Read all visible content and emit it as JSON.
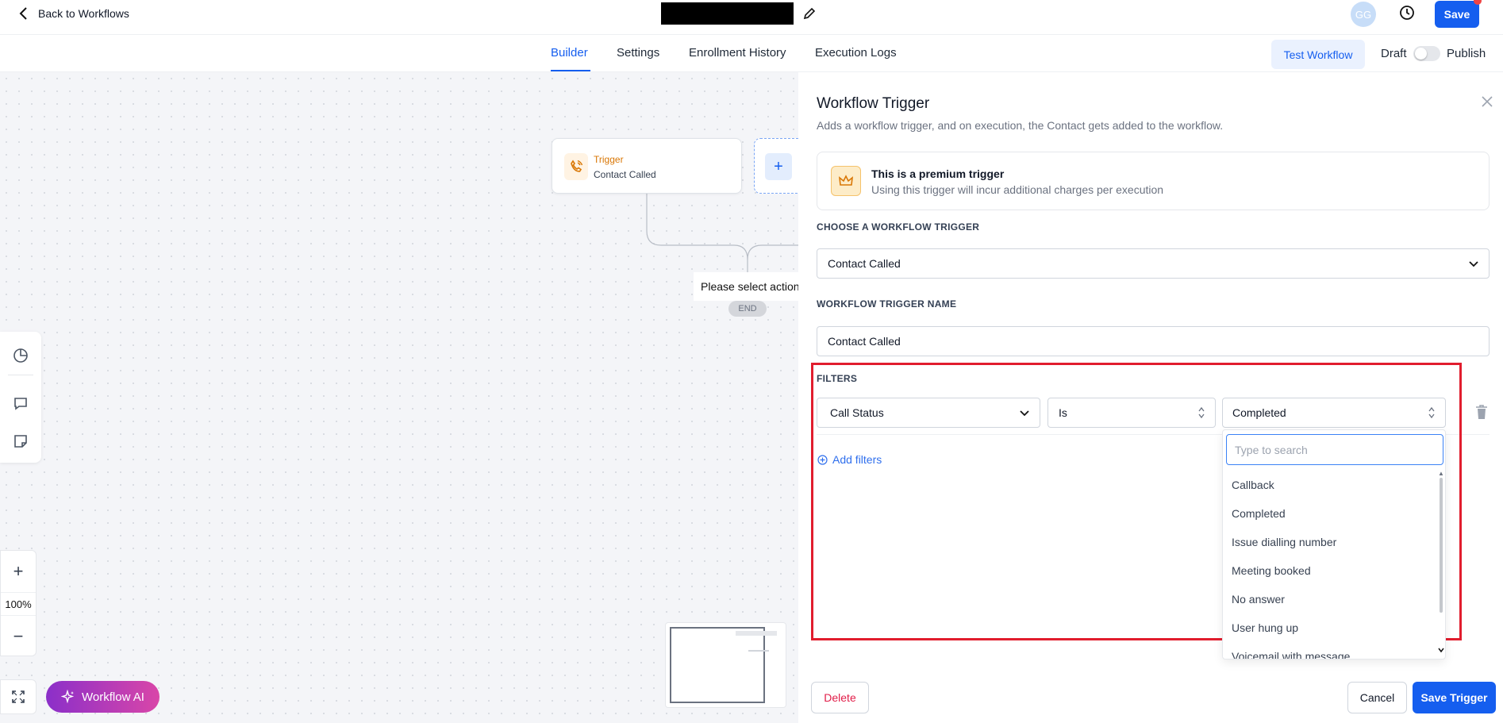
{
  "header": {
    "back_label": "Back to Workflows",
    "avatar_initials": "GG",
    "save_label": "Save"
  },
  "tabs": {
    "items": [
      {
        "label": "Builder",
        "active": true
      },
      {
        "label": "Settings"
      },
      {
        "label": "Enrollment History"
      },
      {
        "label": "Execution Logs"
      }
    ],
    "test_label": "Test Workflow",
    "draft_label": "Draft",
    "publish_label": "Publish",
    "publish_toggle_on": false
  },
  "canvas": {
    "trigger_node": {
      "label": "Trigger",
      "subtitle": "Contact Called"
    },
    "add_label": "+",
    "tooltip": "Please select action",
    "end_label": "END",
    "zoom_in": "+",
    "zoom_level": "100%",
    "zoom_out": "−",
    "ai_label": "Workflow AI"
  },
  "panel": {
    "title": "Workflow Trigger",
    "subtitle": "Adds a workflow trigger, and on execution, the Contact gets added to the workflow.",
    "premium": {
      "title": "This is a premium trigger",
      "subtitle": "Using this trigger will incur additional charges per execution"
    },
    "choose_label": "CHOOSE A WORKFLOW TRIGGER",
    "trigger_value": "Contact Called",
    "name_label": "WORKFLOW TRIGGER NAME",
    "name_value": "Contact Called",
    "filters_label": "FILTERS",
    "filter": {
      "field": "Call Status",
      "operator": "Is",
      "value": "Completed"
    },
    "add_filters_label": "Add filters",
    "dropdown": {
      "search_placeholder": "Type to search",
      "options": [
        "Callback",
        "Completed",
        "Issue dialling number",
        "Meeting booked",
        "No answer",
        "User hung up",
        "Voicemail with message"
      ]
    },
    "delete_label": "Delete",
    "cancel_label": "Cancel",
    "save_trigger_label": "Save Trigger"
  },
  "colors": {
    "primary": "#155eef",
    "highlight_border": "#e11d2e",
    "trigger_accent": "#d97706",
    "ai_gradient_start": "#8b2fc9",
    "ai_gradient_end": "#d946a8"
  }
}
